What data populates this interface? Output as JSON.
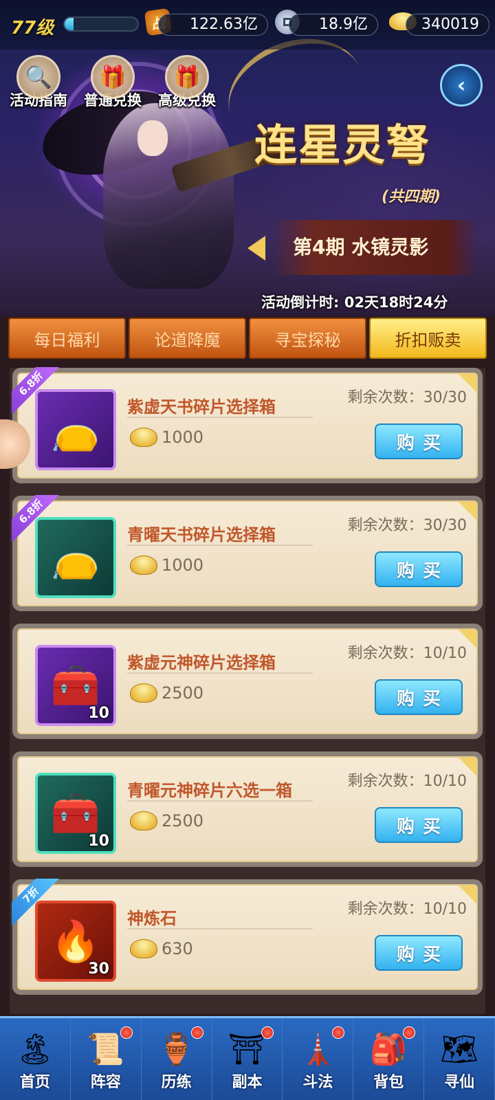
{
  "header": {
    "level": "77级",
    "exp_percent": 12,
    "resources": [
      {
        "icon": "battle-power-icon",
        "glyph": "战",
        "value": "122.63亿"
      },
      {
        "icon": "copper-coin-icon",
        "glyph": "",
        "value": "18.9亿"
      },
      {
        "icon": "gold-ingot-icon",
        "glyph": "",
        "value": "340019"
      }
    ]
  },
  "top_buttons": [
    {
      "icon": "search-icon",
      "glyph": "🔍",
      "label": "活动指南"
    },
    {
      "icon": "gift-box-icon",
      "glyph": "🎁",
      "label": "普通兑换"
    },
    {
      "icon": "gift-icon",
      "glyph": "🎁",
      "label": "高级兑换"
    }
  ],
  "banner": {
    "title": "连星灵弩",
    "subtitle": "(共四期)",
    "period": "第4期 水镜灵影",
    "countdown_label": "活动倒计时:",
    "countdown_value": "02天18时24分"
  },
  "tabs": [
    {
      "label": "每日福利",
      "active": false
    },
    {
      "label": "论道降魔",
      "active": false
    },
    {
      "label": "寻宝探秘",
      "active": false
    },
    {
      "label": "折扣贩卖",
      "active": true
    }
  ],
  "items": [
    {
      "discount": "6.8折",
      "discount_color": "purple",
      "frame": "purple",
      "icon": "bundle-bag-icon",
      "glyph": "👝",
      "count": "",
      "name": "紫虚天书碎片选择箱",
      "price": "1000",
      "remaining": "剩余次数：30/30",
      "buy_label": "购买"
    },
    {
      "discount": "6.8折",
      "discount_color": "purple",
      "frame": "teal",
      "icon": "bundle-bag-icon",
      "glyph": "👝",
      "count": "",
      "name": "青曜天书碎片选择箱",
      "price": "1000",
      "remaining": "剩余次数：30/30",
      "buy_label": "购买"
    },
    {
      "discount": "",
      "discount_color": "",
      "frame": "purple",
      "icon": "treasure-chest-icon",
      "glyph": "🧰",
      "count": "10",
      "name": "紫虚元神碎片选择箱",
      "price": "2500",
      "remaining": "剩余次数：10/10",
      "buy_label": "购买"
    },
    {
      "discount": "",
      "discount_color": "",
      "frame": "teal",
      "icon": "treasure-chest-icon",
      "glyph": "🧰",
      "count": "10",
      "name": "青曜元神碎片六选一箱",
      "price": "2500",
      "remaining": "剩余次数：10/10",
      "buy_label": "购买"
    },
    {
      "discount": "7折",
      "discount_color": "blue",
      "frame": "red",
      "icon": "fire-stone-icon",
      "glyph": "🔥",
      "count": "30",
      "name": "神炼石",
      "price": "630",
      "remaining": "剩余次数：10/10",
      "buy_label": "购买"
    }
  ],
  "bottom_nav": [
    {
      "label": "首页",
      "icon": "home-island-icon",
      "glyph": "🏝",
      "badge": false
    },
    {
      "label": "阵容",
      "icon": "scroll-icon",
      "glyph": "📜",
      "badge": true
    },
    {
      "label": "历练",
      "icon": "jade-pot-icon",
      "glyph": "🏺",
      "badge": true
    },
    {
      "label": "副本",
      "icon": "gate-icon",
      "glyph": "⛩",
      "badge": true
    },
    {
      "label": "斗法",
      "icon": "tower-icon",
      "glyph": "🗼",
      "badge": true
    },
    {
      "label": "背包",
      "icon": "bag-icon",
      "glyph": "🎒",
      "badge": true
    },
    {
      "label": "寻仙",
      "icon": "map-scroll-icon",
      "glyph": "🗺",
      "badge": false
    }
  ]
}
